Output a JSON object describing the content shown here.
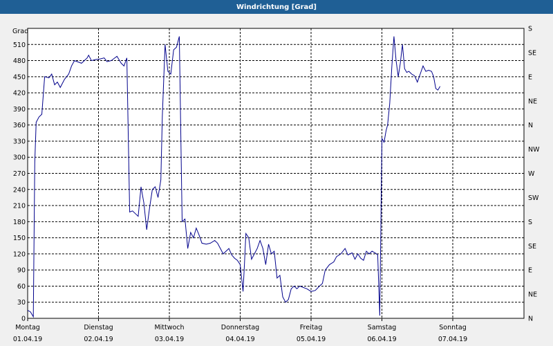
{
  "window": {
    "title": "Windrichtung [Grad]"
  },
  "chart_data": {
    "type": "line",
    "title": "Windrichtung [Grad]",
    "ylabel": "Grad",
    "xlabel": "",
    "ylim": [
      0,
      540
    ],
    "y_ticks": [
      0,
      30,
      60,
      90,
      120,
      150,
      180,
      210,
      240,
      270,
      300,
      330,
      360,
      390,
      420,
      450,
      480,
      510
    ],
    "y_right_labels": [
      "N",
      "NE",
      "E",
      "SE",
      "S",
      "SW",
      "W",
      "NW",
      "N",
      "NE",
      "E",
      "SE",
      "S"
    ],
    "x_domain_days": [
      0,
      7
    ],
    "x_ticks": [
      {
        "day": 0,
        "weekday": "Montag",
        "date": "01.04.19"
      },
      {
        "day": 1,
        "weekday": "Dienstag",
        "date": "02.04.19"
      },
      {
        "day": 2,
        "weekday": "Mittwoch",
        "date": "03.04.19"
      },
      {
        "day": 3,
        "weekday": "Donnerstag",
        "date": "04.04.19"
      },
      {
        "day": 4,
        "weekday": "Freitag",
        "date": "05.04.19"
      },
      {
        "day": 5,
        "weekday": "Samstag",
        "date": "06.04.19"
      },
      {
        "day": 6,
        "weekday": "Sonntag",
        "date": "07.04.19"
      }
    ],
    "grid": true,
    "line_color": "#00008b",
    "series": [
      {
        "name": "",
        "points": [
          [
            0.0,
            15
          ],
          [
            0.04,
            12
          ],
          [
            0.08,
            3
          ],
          [
            0.1,
            290
          ],
          [
            0.12,
            365
          ],
          [
            0.16,
            375
          ],
          [
            0.2,
            380
          ],
          [
            0.24,
            450
          ],
          [
            0.3,
            448
          ],
          [
            0.34,
            455
          ],
          [
            0.38,
            435
          ],
          [
            0.42,
            440
          ],
          [
            0.46,
            430
          ],
          [
            0.52,
            445
          ],
          [
            0.58,
            455
          ],
          [
            0.62,
            470
          ],
          [
            0.66,
            480
          ],
          [
            0.7,
            478
          ],
          [
            0.76,
            475
          ],
          [
            0.8,
            480
          ],
          [
            0.84,
            485
          ],
          [
            0.86,
            490
          ],
          [
            0.9,
            480
          ],
          [
            0.96,
            482
          ],
          [
            1.02,
            483
          ],
          [
            1.08,
            485
          ],
          [
            1.12,
            478
          ],
          [
            1.18,
            480
          ],
          [
            1.26,
            488
          ],
          [
            1.32,
            475
          ],
          [
            1.36,
            470
          ],
          [
            1.4,
            485
          ],
          [
            1.44,
            198
          ],
          [
            1.48,
            200
          ],
          [
            1.52,
            195
          ],
          [
            1.56,
            190
          ],
          [
            1.6,
            245
          ],
          [
            1.64,
            215
          ],
          [
            1.68,
            165
          ],
          [
            1.72,
            205
          ],
          [
            1.76,
            240
          ],
          [
            1.8,
            245
          ],
          [
            1.84,
            225
          ],
          [
            1.88,
            258
          ],
          [
            1.9,
            375
          ],
          [
            1.94,
            510
          ],
          [
            1.98,
            460
          ],
          [
            2.02,
            455
          ],
          [
            2.06,
            500
          ],
          [
            2.1,
            505
          ],
          [
            2.14,
            525
          ],
          [
            2.18,
            180
          ],
          [
            2.22,
            185
          ],
          [
            2.26,
            130
          ],
          [
            2.3,
            160
          ],
          [
            2.34,
            150
          ],
          [
            2.38,
            168
          ],
          [
            2.42,
            155
          ],
          [
            2.46,
            140
          ],
          [
            2.52,
            138
          ],
          [
            2.58,
            140
          ],
          [
            2.64,
            145
          ],
          [
            2.68,
            140
          ],
          [
            2.72,
            130
          ],
          [
            2.76,
            120
          ],
          [
            2.8,
            125
          ],
          [
            2.84,
            130
          ],
          [
            2.88,
            118
          ],
          [
            2.92,
            112
          ],
          [
            2.96,
            108
          ],
          [
            3.0,
            100
          ],
          [
            3.04,
            50
          ],
          [
            3.06,
            100
          ],
          [
            3.08,
            158
          ],
          [
            3.12,
            150
          ],
          [
            3.16,
            110
          ],
          [
            3.2,
            120
          ],
          [
            3.24,
            130
          ],
          [
            3.28,
            145
          ],
          [
            3.32,
            130
          ],
          [
            3.36,
            100
          ],
          [
            3.4,
            138
          ],
          [
            3.44,
            120
          ],
          [
            3.48,
            125
          ],
          [
            3.52,
            75
          ],
          [
            3.56,
            80
          ],
          [
            3.6,
            40
          ],
          [
            3.64,
            30
          ],
          [
            3.68,
            35
          ],
          [
            3.72,
            55
          ],
          [
            3.76,
            60
          ],
          [
            3.8,
            55
          ],
          [
            3.84,
            60
          ],
          [
            3.88,
            58
          ],
          [
            3.94,
            55
          ],
          [
            4.0,
            50
          ],
          [
            4.06,
            52
          ],
          [
            4.12,
            60
          ],
          [
            4.16,
            65
          ],
          [
            4.2,
            90
          ],
          [
            4.26,
            100
          ],
          [
            4.32,
            105
          ],
          [
            4.36,
            115
          ],
          [
            4.42,
            120
          ],
          [
            4.48,
            130
          ],
          [
            4.52,
            118
          ],
          [
            4.58,
            122
          ],
          [
            4.62,
            110
          ],
          [
            4.66,
            120
          ],
          [
            4.7,
            112
          ],
          [
            4.74,
            108
          ],
          [
            4.78,
            125
          ],
          [
            4.82,
            120
          ],
          [
            4.86,
            125
          ],
          [
            4.9,
            122
          ],
          [
            4.94,
            118
          ],
          [
            4.97,
            5
          ],
          [
            5.0,
            335
          ],
          [
            5.03,
            328
          ],
          [
            5.06,
            350
          ],
          [
            5.08,
            360
          ],
          [
            5.11,
            400
          ],
          [
            5.14,
            470
          ],
          [
            5.17,
            525
          ],
          [
            5.2,
            480
          ],
          [
            5.23,
            450
          ],
          [
            5.26,
            475
          ],
          [
            5.29,
            510
          ],
          [
            5.32,
            465
          ],
          [
            5.35,
            458
          ],
          [
            5.38,
            460
          ],
          [
            5.42,
            455
          ],
          [
            5.46,
            452
          ],
          [
            5.5,
            440
          ],
          [
            5.54,
            455
          ],
          [
            5.58,
            470
          ],
          [
            5.62,
            460
          ],
          [
            5.66,
            462
          ],
          [
            5.7,
            460
          ],
          [
            5.73,
            450
          ],
          [
            5.76,
            428
          ],
          [
            5.79,
            425
          ],
          [
            5.82,
            432
          ]
        ]
      }
    ]
  }
}
